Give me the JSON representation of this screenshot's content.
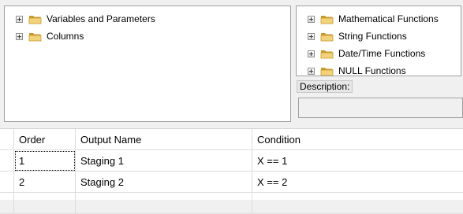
{
  "left_tree": {
    "nodes": [
      {
        "label": "Variables and Parameters",
        "icon": "folder-icon"
      },
      {
        "label": "Columns",
        "icon": "folder-icon"
      }
    ]
  },
  "right_tree": {
    "nodes": [
      {
        "label": "Mathematical Functions",
        "icon": "folder-icon"
      },
      {
        "label": "String Functions",
        "icon": "folder-icon"
      },
      {
        "label": "Date/Time Functions",
        "icon": "folder-icon"
      },
      {
        "label": "NULL Functions",
        "icon": "folder-icon"
      }
    ]
  },
  "description": {
    "label": "Description:",
    "value": ""
  },
  "grid": {
    "columns": [
      "Order",
      "Output Name",
      "Condition"
    ],
    "rows": [
      {
        "order": "1",
        "output_name": "Staging 1",
        "condition": "X == 1"
      },
      {
        "order": "2",
        "output_name": "Staging 2",
        "condition": "X == 2"
      },
      {
        "order": "",
        "output_name": "",
        "condition": ""
      }
    ]
  },
  "colors": {
    "folder": "#e8c25a",
    "folder_dark": "#c9992b",
    "border": "#a0a0a0",
    "panel": "#f0f0f0"
  }
}
